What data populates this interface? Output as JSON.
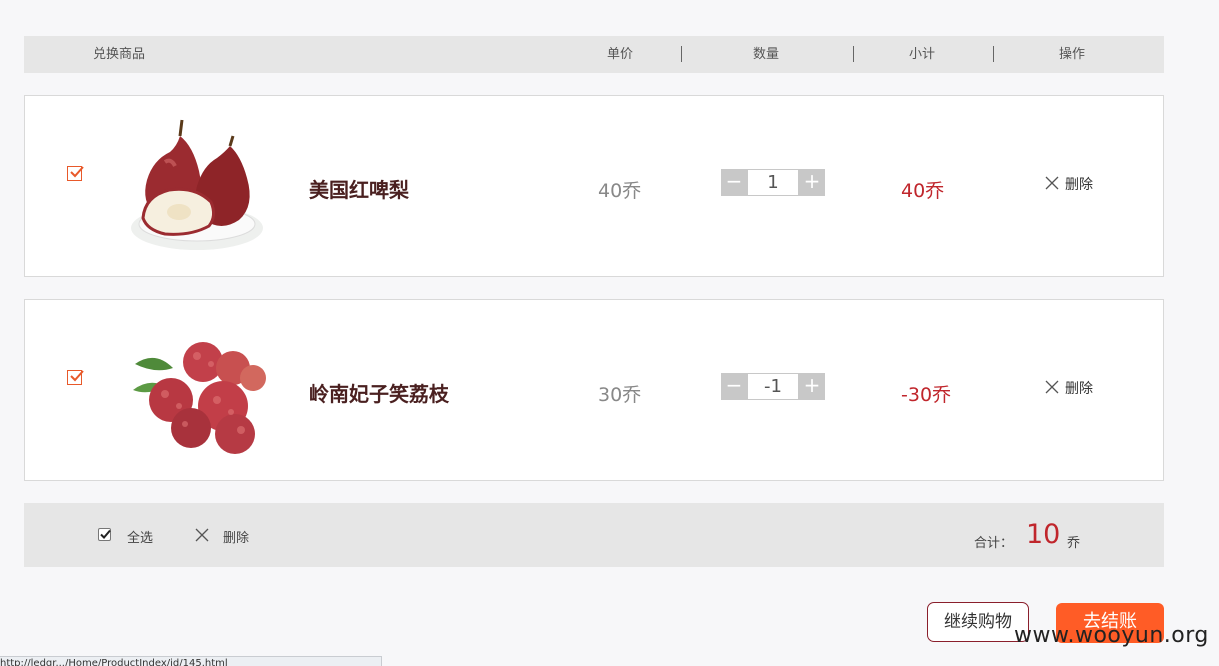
{
  "header": {
    "product_col": "兑换商品",
    "price_col": "单价",
    "qty_col": "数量",
    "subtotal_col": "小计",
    "action_col": "操作"
  },
  "items": [
    {
      "name": "美国红啤梨",
      "price": "40乔",
      "quantity": "1",
      "subtotal": "40乔",
      "checked": true,
      "image": "red-pear-icon",
      "delete_label": "删除"
    },
    {
      "name": "岭南妃子笑荔枝",
      "price": "30乔",
      "quantity": "-1",
      "subtotal": "-30乔",
      "checked": true,
      "image": "lychee-icon",
      "delete_label": "删除"
    }
  ],
  "footer": {
    "select_all": "全选",
    "delete": "删除",
    "total_label": "合计：",
    "total_value": "10",
    "total_unit": "乔"
  },
  "buttons": {
    "continue": "继续购物",
    "checkout": "去结账"
  },
  "watermark": "www.wooyun.org",
  "status_url": "http://ledgr.../Home/ProductIndex/id/145.html",
  "colors": {
    "accent": "#ff5c26",
    "price_red": "#c0262c",
    "checkbox": "#e8592a"
  }
}
